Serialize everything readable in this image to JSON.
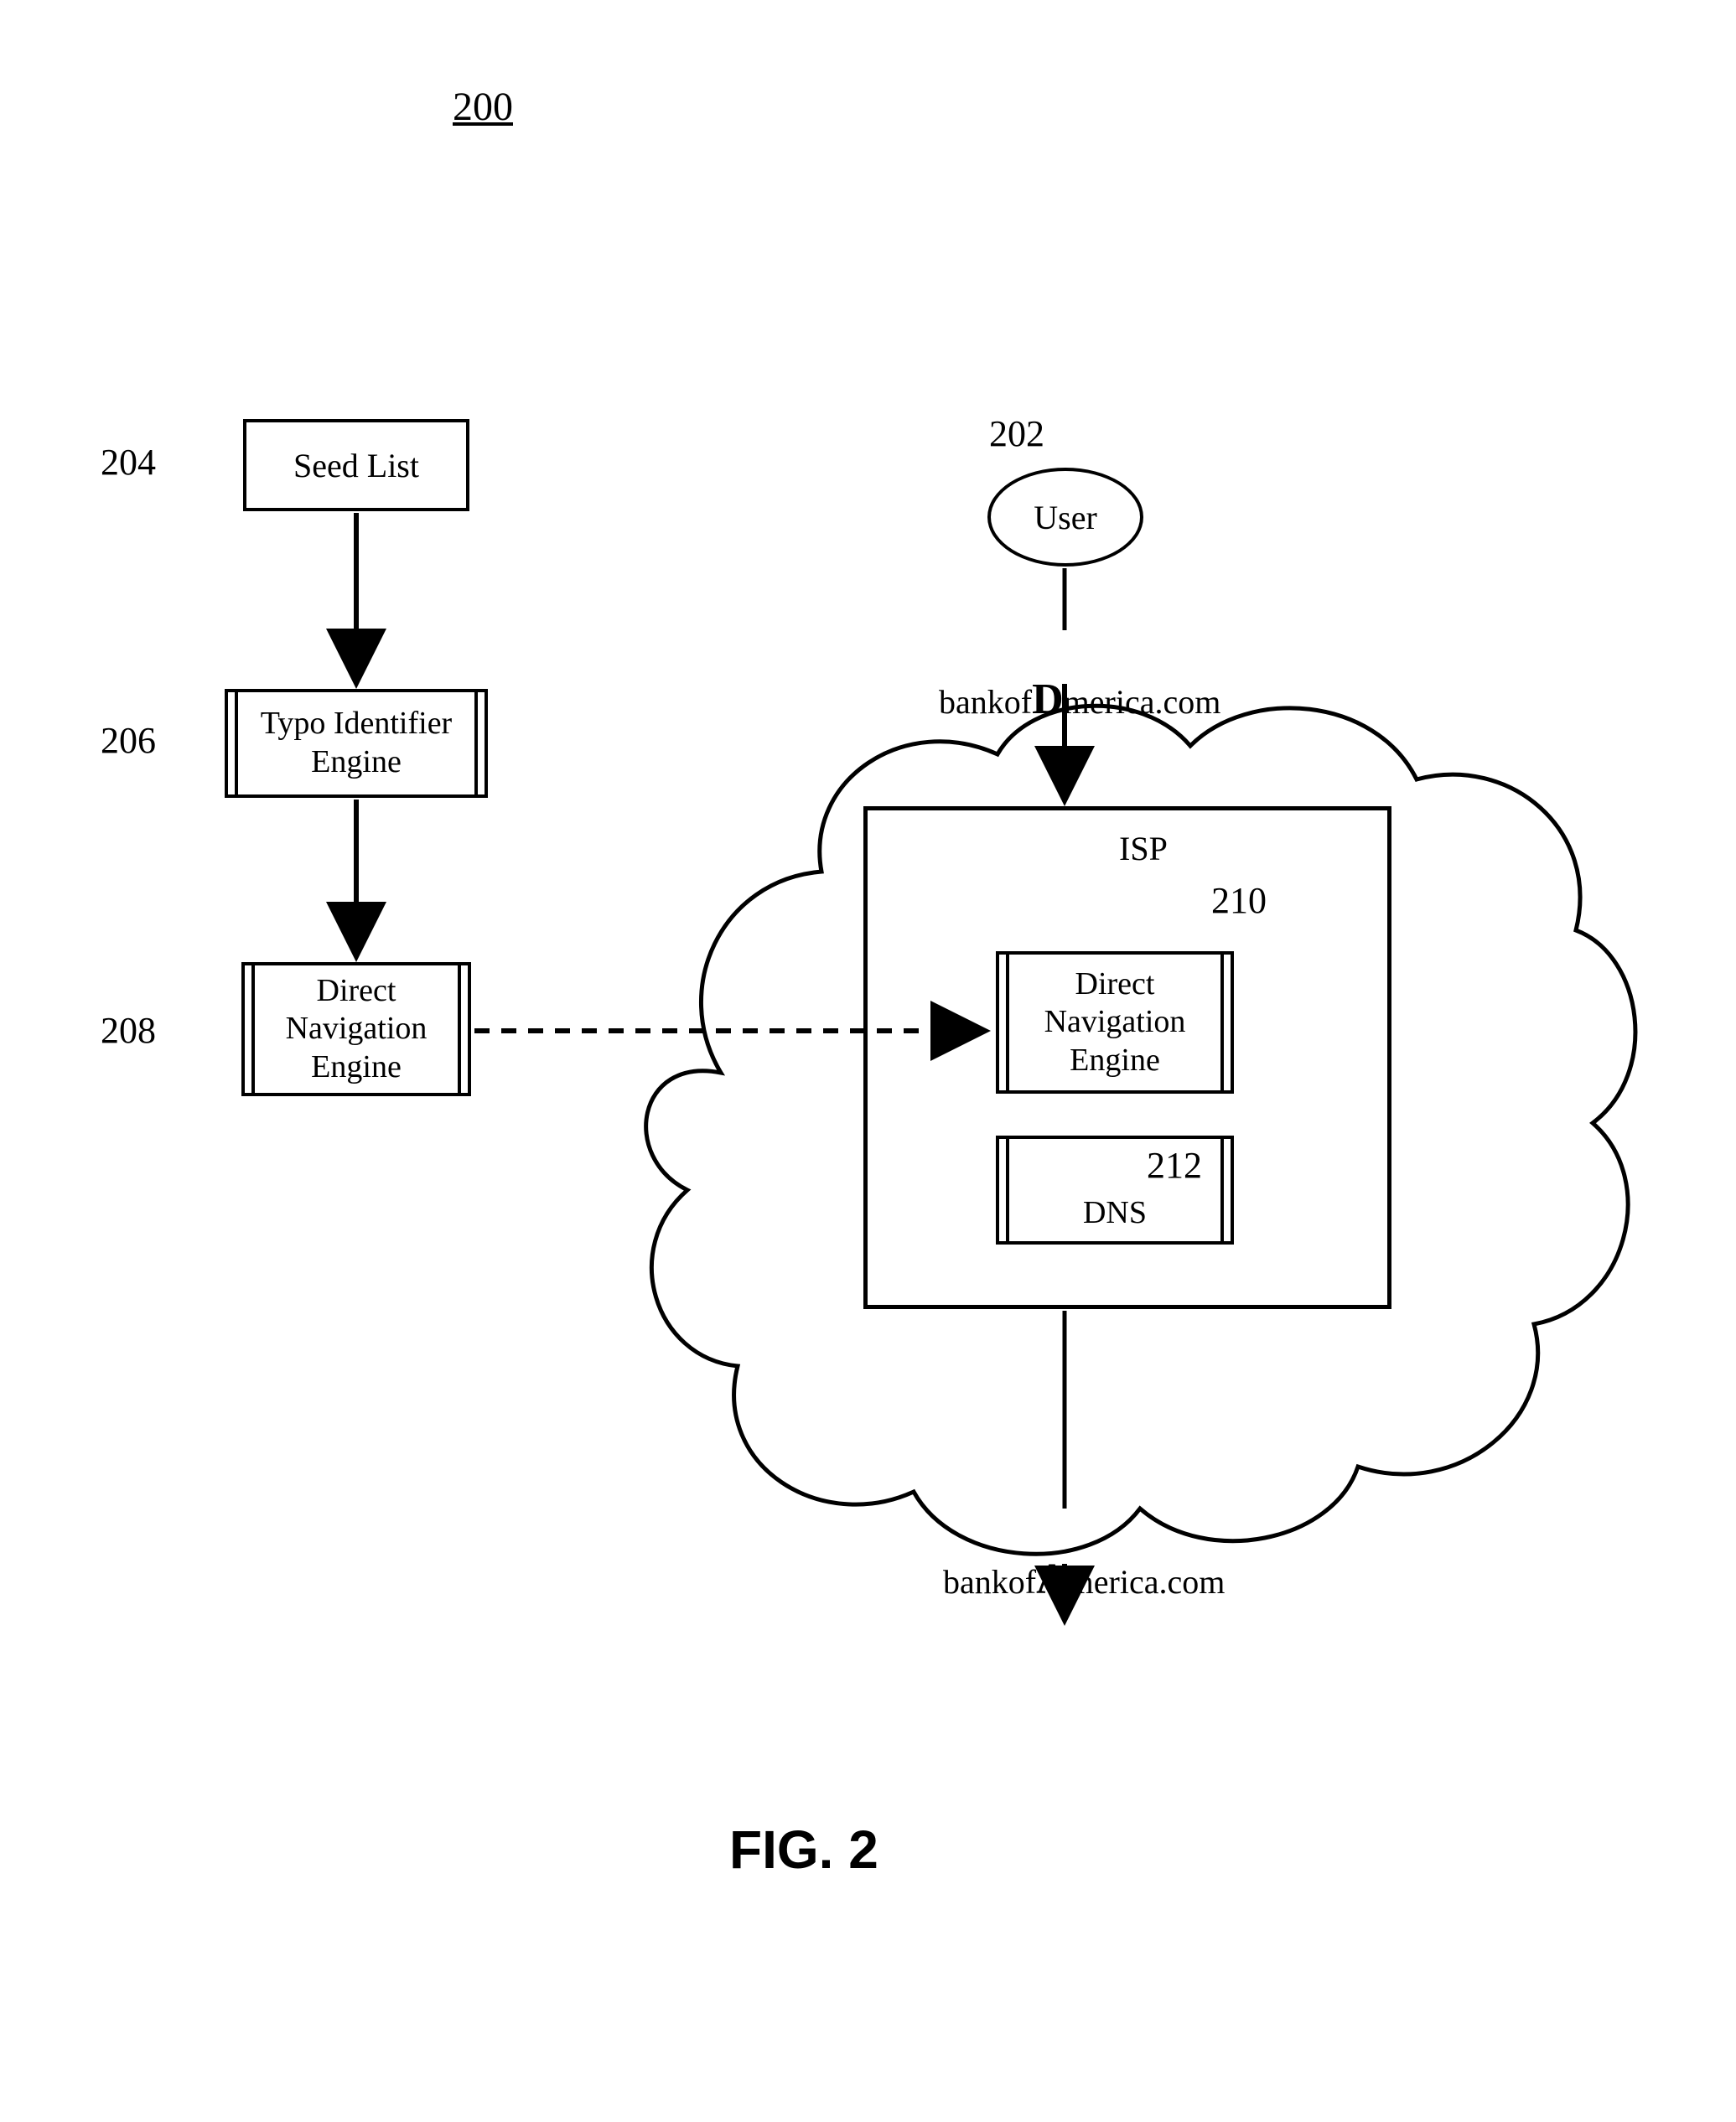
{
  "figure": {
    "number": "200",
    "caption": "FIG. 2"
  },
  "labels": {
    "n202": "202",
    "n204": "204",
    "n206": "206",
    "n208": "208",
    "n210": "210",
    "n212": "212"
  },
  "nodes": {
    "seed_list": "Seed List",
    "typo_engine": "Typo Identifier\nEngine",
    "direct_nav_left": "Direct\nNavigation\nEngine",
    "user": "User",
    "isp": "ISP",
    "direct_nav_right": "Direct\nNavigation\nEngine",
    "dns": "DNS"
  },
  "text": {
    "typo_domain_prefix": "bankof",
    "typo_domain_em": "D",
    "typo_domain_suffix": "merica.com",
    "correct_domain_prefix": "bankof",
    "correct_domain_em": "A",
    "correct_domain_suffix": "merica.com"
  }
}
